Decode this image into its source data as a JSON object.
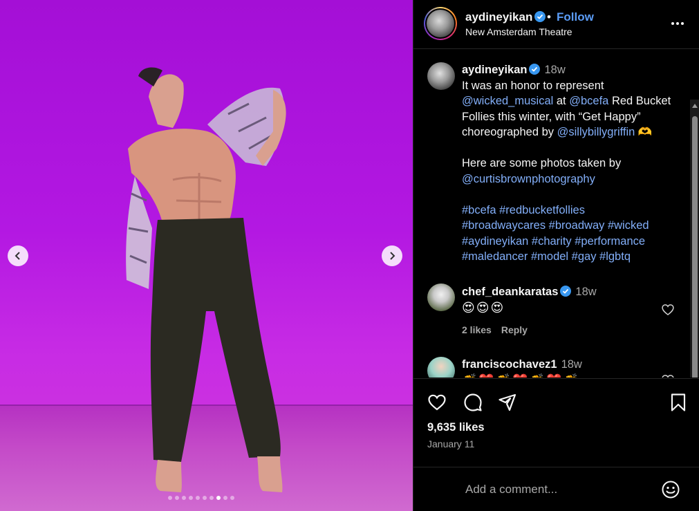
{
  "post": {
    "username": "aydineyikan",
    "separator": "•",
    "follow_label": "Follow",
    "location": "New Amsterdam Theatre",
    "carousel": {
      "total_slides": 10,
      "active_slide": 8
    }
  },
  "caption": {
    "username": "aydineyikan",
    "time": "18w",
    "lines": [
      [
        {
          "t": "It was an honor to represent",
          "link": false
        }
      ],
      [
        {
          "t": "@wicked_musical",
          "link": true
        },
        {
          "t": " at ",
          "link": false
        },
        {
          "t": "@bcefa",
          "link": true
        },
        {
          "t": " Red Bucket",
          "link": false
        }
      ],
      [
        {
          "t": "Follies this winter, with “Get Happy”",
          "link": false
        }
      ],
      [
        {
          "t": "choreographed by ",
          "link": false
        },
        {
          "t": "@sillybillygriffin",
          "link": true
        },
        {
          "t": " 🫶",
          "link": false
        }
      ],
      [
        {
          "t": "",
          "link": false
        }
      ],
      [
        {
          "t": "Here are some photos taken by",
          "link": false
        }
      ],
      [
        {
          "t": "@curtisbrownphotography",
          "link": true
        }
      ],
      [
        {
          "t": "",
          "link": false
        }
      ],
      [
        {
          "t": "#bcefa #redbucketfollies",
          "link": true
        }
      ],
      [
        {
          "t": "#broadwaycares #broadway #wicked",
          "link": true
        }
      ],
      [
        {
          "t": "#aydineyikan #charity #performance",
          "link": true
        }
      ],
      [
        {
          "t": "#maledancer #model #gay #lgbtq",
          "link": true
        }
      ]
    ]
  },
  "comments": [
    {
      "username": "chef_deankaratas",
      "verified": true,
      "time": "18w",
      "text": "😍😍😍",
      "likes": "2 likes",
      "reply": "Reply"
    },
    {
      "username": "franciscochavez1",
      "verified": false,
      "time": "18w",
      "text": "👏❤️👏❤️👏❤️👏"
    }
  ],
  "actions": {
    "likes": "9,635 likes",
    "date": "January 11"
  },
  "add_comment": {
    "placeholder": "Add a comment..."
  },
  "colors": {
    "link": "#82aef8",
    "follow": "#5b9cf6",
    "verified": "#3897f0",
    "stage_purple": "#b318e2"
  },
  "icons": [
    "chevron-left-icon",
    "chevron-right-icon",
    "verified-badge-icon",
    "more-options-icon",
    "heart-icon",
    "comment-icon",
    "share-icon",
    "bookmark-icon",
    "emoji-icon"
  ]
}
